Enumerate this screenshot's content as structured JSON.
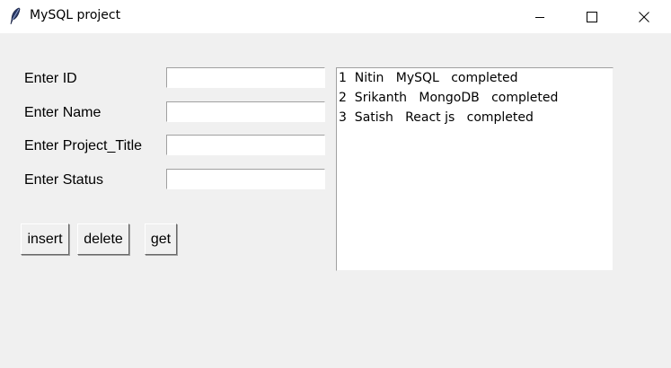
{
  "window": {
    "title": "MySQL project",
    "icon": "feather-icon",
    "controls": {
      "minimize": "minimize-icon",
      "maximize": "maximize-icon",
      "close": "close-icon"
    }
  },
  "form": {
    "id_label": "Enter ID",
    "name_label": "Enter Name",
    "project_title_label": "Enter Project_Title",
    "status_label": "Enter Status",
    "id_value": "",
    "name_value": "",
    "project_title_value": "",
    "status_value": ""
  },
  "buttons": {
    "insert": "insert",
    "delete": "delete",
    "get": "get"
  },
  "records": [
    "1  Nitin   MySQL   completed",
    "2  Srikanth   MongoDB   completed",
    "3  Satish   React js   completed"
  ]
}
